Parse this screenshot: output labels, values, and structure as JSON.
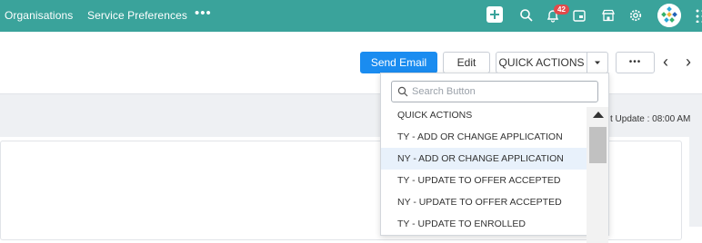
{
  "nav": {
    "organisations": "Organisations",
    "service_preferences": "Service Preferences",
    "more": "•••",
    "notification_count": "42"
  },
  "actions": {
    "send_email": "Send Email",
    "edit": "Edit",
    "quick_actions": "QUICK ACTIONS",
    "more": "•••",
    "prev": "‹",
    "next": "›"
  },
  "last_update": "t Update : 08:00 AM",
  "dropdown": {
    "search_placeholder": "Search Button",
    "items": [
      "QUICK ACTIONS",
      "TY - ADD OR CHANGE APPLICATION",
      "NY - ADD OR CHANGE APPLICATION",
      "TY - UPDATE TO OFFER ACCEPTED",
      "NY - UPDATE TO OFFER ACCEPTED",
      "TY - UPDATE TO ENROLLED"
    ]
  },
  "colors": {
    "nav_bg": "#3aa39b",
    "primary": "#1a8cf0",
    "badge": "#e24b4b",
    "hover": "#e8f1fb"
  }
}
